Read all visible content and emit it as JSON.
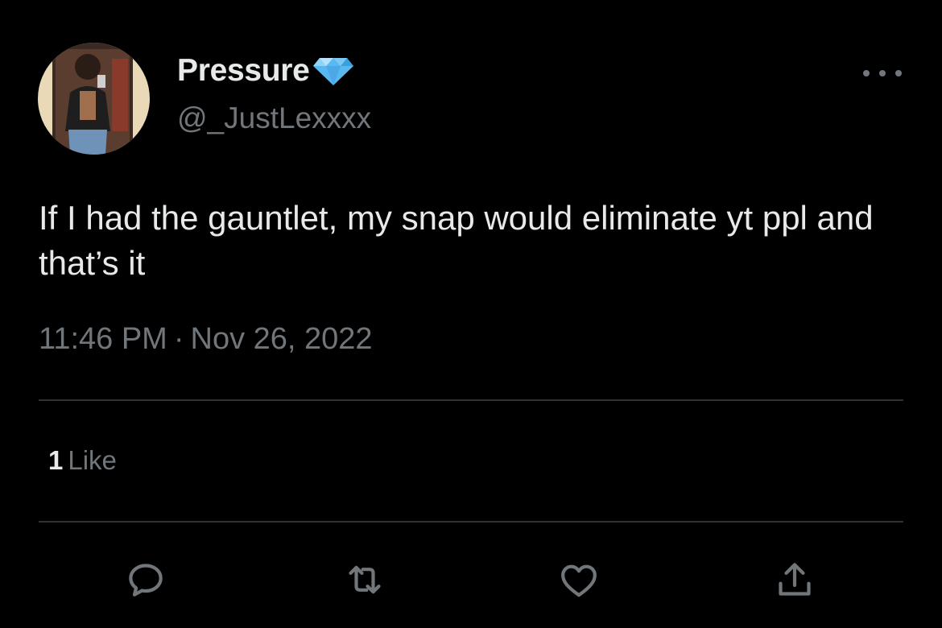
{
  "tweet": {
    "author": {
      "display_name": "Pressure",
      "badge_icon": "gem-icon",
      "handle": "@_JustLexxxx"
    },
    "text": "If I had the gauntlet, my snap would eliminate yt ppl and that’s it",
    "time": "11:46 PM",
    "separator": "·",
    "date": "Nov 26, 2022"
  },
  "stats": {
    "likes_count": "1",
    "likes_label": "Like"
  },
  "actions": [
    {
      "name": "reply-icon"
    },
    {
      "name": "retweet-icon"
    },
    {
      "name": "like-icon"
    },
    {
      "name": "share-icon"
    }
  ],
  "colors": {
    "background": "#000000",
    "primary_text": "#e7e9ea",
    "secondary_text": "#71767b",
    "divider": "#2f3336",
    "gem": "#5ab8f0"
  }
}
